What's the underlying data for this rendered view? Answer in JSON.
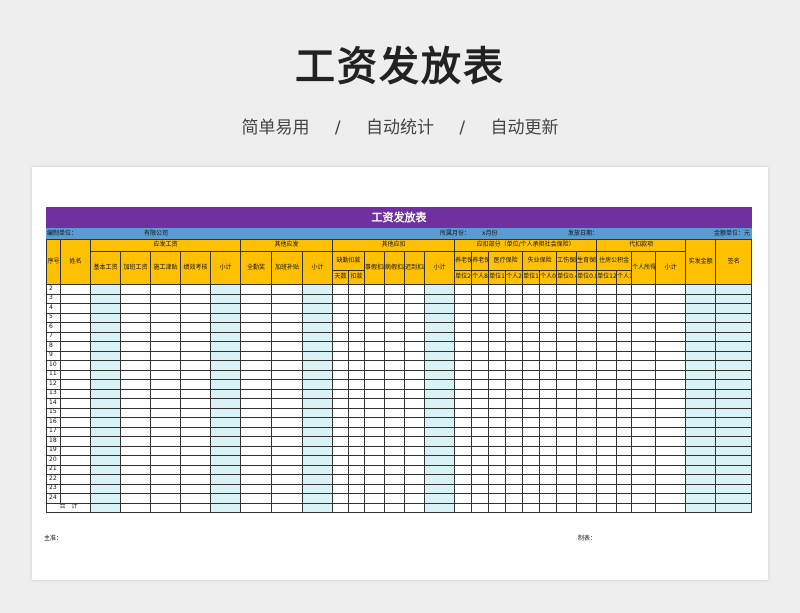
{
  "hero": {
    "title": "工资发放表",
    "features": [
      "简单易用",
      "自动统计",
      "自动更新"
    ],
    "separator": "/"
  },
  "sheet": {
    "band_title": "工资发放表",
    "info": {
      "unit_label": "编制单位：",
      "unit_value": "有限公司",
      "month_label": "所属月份：",
      "month_value": "x月份",
      "date_label": "发放日期：",
      "currency_label": "金额单位：元"
    },
    "header": {
      "seq": "序号",
      "name": "姓名",
      "payable": "应发工资",
      "payable_cols": [
        "基本工资",
        "加班工资",
        "施工津贴",
        "绩效考核",
        "小计"
      ],
      "other_payable": "其他应发",
      "other_payable_cols": [
        "全勤奖",
        "加班补贴",
        "小计"
      ],
      "other_deduct": "其他应扣",
      "absence": "缺勤扣款",
      "absence_cols": [
        "天数",
        "扣款"
      ],
      "other_deduct_cols": [
        "事假扣款",
        "病假扣款",
        "迟到扣款",
        "小计"
      ],
      "insurance": "应扣部分（单位/个人承担社会保险）",
      "pension": "养老保险",
      "pension2": "养老保险",
      "medical": "医疗保险",
      "unemployment": "失业保险",
      "injury": "工伤保险",
      "maternity": "生育保险",
      "rates": [
        "单位20%",
        "个人8%",
        "单位10%",
        "个人2%+3",
        "单位1.5%",
        "个人0.5%",
        "单位0.4%",
        "单位0.8%"
      ],
      "withhold": "代扣款项",
      "housing": "住房公积金",
      "housing_rates": [
        "单位12%",
        "个人12%"
      ],
      "income_tax": "个人所得税",
      "withhold_subtotal": "小计",
      "net_pay": "实发金额",
      "signature": "签名"
    },
    "rows": [
      "2",
      "3",
      "4",
      "5",
      "6",
      "7",
      "8",
      "9",
      "10",
      "11",
      "12",
      "13",
      "14",
      "15",
      "16",
      "17",
      "18",
      "19",
      "20",
      "21",
      "22",
      "23",
      "24"
    ],
    "total_label": "合　计"
  },
  "footer": {
    "approver_label": "主准：",
    "preparer_label": "制表："
  },
  "colors": {
    "band": "#7030a0",
    "info_bar": "#5b9bd5",
    "header": "#ffc000",
    "subtotal_column": "#d9f2f5"
  }
}
